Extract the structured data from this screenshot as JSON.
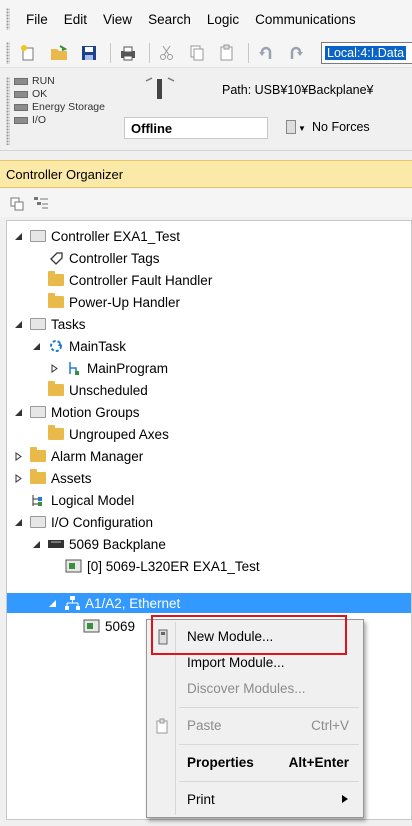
{
  "menubar": {
    "items": [
      "File",
      "Edit",
      "View",
      "Search",
      "Logic",
      "Communications"
    ]
  },
  "toolbar": {
    "icons": [
      "new-icon",
      "open-icon",
      "save-icon",
      "print-icon",
      "cut-icon",
      "copy-icon",
      "paste-icon",
      "undo-icon",
      "redo-icon"
    ],
    "tag_field": "Local:4:I.Data"
  },
  "status": {
    "indicators": [
      "RUN",
      "OK",
      "Energy Storage",
      "I/O"
    ],
    "path": "Path: USB¥10¥Backplane¥",
    "mode": "Offline",
    "forces": "No Forces"
  },
  "organizer": {
    "title": "Controller Organizer"
  },
  "tree": {
    "controller": "Controller EXA1_Test",
    "controller_tags": "Controller Tags",
    "fault_handler": "Controller Fault Handler",
    "powerup_handler": "Power-Up Handler",
    "tasks": "Tasks",
    "main_task": "MainTask",
    "main_program": "MainProgram",
    "unscheduled": "Unscheduled",
    "motion_groups": "Motion Groups",
    "ungrouped_axes": "Ungrouped Axes",
    "alarm_manager": "Alarm Manager",
    "assets": "Assets",
    "logical_model": "Logical Model",
    "io_config": "I/O Configuration",
    "backplane": "5069 Backplane",
    "controller_module": "[0] 5069-L320ER EXA1_Test",
    "ethernet": "A1/A2, Ethernet",
    "child_module": "5069"
  },
  "context_menu": {
    "new_module": "New Module...",
    "import_module": "Import Module...",
    "discover_modules": "Discover Modules...",
    "paste": "Paste",
    "paste_shortcut": "Ctrl+V",
    "properties": "Properties",
    "properties_shortcut": "Alt+Enter",
    "print": "Print"
  },
  "colors": {
    "selection": "#3399ff",
    "organizer_header": "#fbe9a8",
    "highlight_box": "#e0131a",
    "folder": "#e9b949"
  }
}
